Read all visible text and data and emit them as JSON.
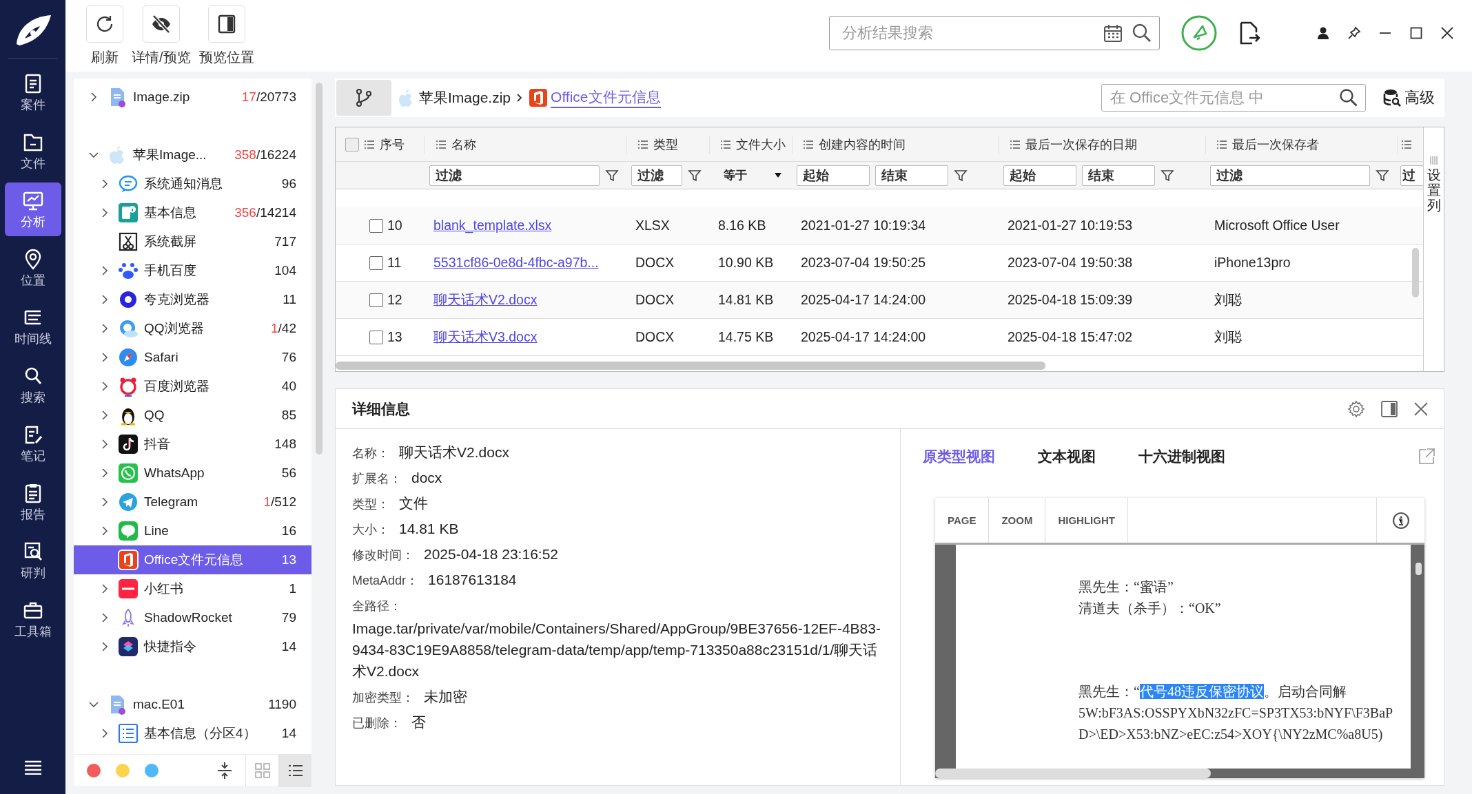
{
  "nav": {
    "items": [
      {
        "label": "案件",
        "selected": false
      },
      {
        "label": "文件",
        "selected": false
      },
      {
        "label": "分析",
        "selected": true
      },
      {
        "label": "位置",
        "selected": false
      },
      {
        "label": "时间线",
        "selected": false
      },
      {
        "label": "搜索",
        "selected": false
      },
      {
        "label": "笔记",
        "selected": false
      },
      {
        "label": "报告",
        "selected": false
      },
      {
        "label": "研判",
        "selected": false
      },
      {
        "label": "工具箱",
        "selected": false
      }
    ]
  },
  "toolbar": {
    "buttons": [
      {
        "label": "刷新"
      },
      {
        "label": "详情/预览"
      },
      {
        "label": "预览位置"
      }
    ]
  },
  "search": {
    "placeholder": "分析结果搜索"
  },
  "tree": [
    {
      "label": "Image.zip",
      "flagged": "17",
      "total": "/20773",
      "expandable": true,
      "expanded": false,
      "selected": false
    },
    {
      "label": "苹果Image...",
      "flagged": "358",
      "total": "/16224",
      "expandable": true,
      "expanded": true,
      "selected": false,
      "children": [
        {
          "label": "系统通知消息",
          "total": "96",
          "expandable": true,
          "expanded": false,
          "selected": false
        },
        {
          "label": "基本信息",
          "flagged": "356",
          "total": "/14214",
          "expandable": true,
          "expanded": false,
          "selected": false
        },
        {
          "label": "系统截屏",
          "total": "717",
          "expandable": false,
          "expanded": false,
          "selected": false
        },
        {
          "label": "手机百度",
          "total": "104",
          "expandable": true,
          "expanded": false,
          "selected": false
        },
        {
          "label": "夸克浏览器",
          "total": "11",
          "expandable": true,
          "expanded": false,
          "selected": false
        },
        {
          "label": "QQ浏览器",
          "flagged": "1",
          "total": "/42",
          "expandable": true,
          "expanded": false,
          "selected": false
        },
        {
          "label": "Safari",
          "total": "76",
          "expandable": true,
          "expanded": false,
          "selected": false
        },
        {
          "label": "百度浏览器",
          "total": "40",
          "expandable": true,
          "expanded": false,
          "selected": false
        },
        {
          "label": "QQ",
          "total": "85",
          "expandable": true,
          "expanded": false,
          "selected": false
        },
        {
          "label": "抖音",
          "total": "148",
          "expandable": true,
          "expanded": false,
          "selected": false
        },
        {
          "label": "WhatsApp",
          "total": "56",
          "expandable": true,
          "expanded": false,
          "selected": false
        },
        {
          "label": "Telegram",
          "flagged": "1",
          "total": "/512",
          "expandable": true,
          "expanded": false,
          "selected": false
        },
        {
          "label": "Line",
          "total": "16",
          "expandable": true,
          "expanded": false,
          "selected": false
        },
        {
          "label": "Office文件元信息",
          "total": "13",
          "expandable": false,
          "expanded": false,
          "selected": true
        },
        {
          "label": "小红书",
          "total": "1",
          "expandable": true,
          "expanded": false,
          "selected": false
        },
        {
          "label": "ShadowRocket",
          "total": "79",
          "expandable": true,
          "expanded": false,
          "selected": false
        },
        {
          "label": "快捷指令",
          "total": "14",
          "expandable": true,
          "expanded": false,
          "selected": false
        }
      ]
    },
    {
      "label": "mac.E01",
      "total": "1190",
      "expandable": true,
      "expanded": true,
      "selected": false,
      "children": [
        {
          "label": "基本信息（分区4）",
          "total": "14",
          "expandable": true,
          "expanded": false,
          "selected": false
        }
      ]
    }
  ],
  "tree_footer": {
    "color_tags": [
      {
        "color": "#f25c5c"
      },
      {
        "color": "#fcd34d"
      },
      {
        "color": "#4fb8f5"
      }
    ],
    "view_modes": [
      {
        "selected": false
      },
      {
        "selected": true
      }
    ]
  },
  "breadcrumb": [
    {
      "label": "苹果Image.zip",
      "selected": false
    },
    {
      "label": "Office文件元信息",
      "selected": true
    }
  ],
  "table_search": {
    "placeholder": "在 Office文件元信息 中"
  },
  "advanced_button": "高级",
  "table": {
    "columns": [
      {
        "label": "序号"
      },
      {
        "label": "名称",
        "filter": {
          "kind": "text",
          "placeholder": "过滤"
        }
      },
      {
        "label": "类型",
        "filter": {
          "kind": "text",
          "placeholder": "过滤"
        }
      },
      {
        "label": "文件大小",
        "filter": {
          "kind": "select",
          "value": "等于"
        }
      },
      {
        "label": "创建内容的时间",
        "filter": {
          "kind": "range",
          "from": {
            "placeholder": "起始"
          },
          "to": {
            "placeholder": "结束"
          }
        }
      },
      {
        "label": "最后一次保存的日期",
        "filter": {
          "kind": "range",
          "from": {
            "placeholder": "起始"
          },
          "to": {
            "placeholder": "结束"
          }
        }
      },
      {
        "label": "最后一次保存者",
        "filter": {
          "kind": "text",
          "placeholder": "过滤"
        }
      },
      {
        "filter": {
          "kind": "text",
          "placeholder": "过"
        }
      }
    ],
    "all_checked": false,
    "settings_column": "设置列",
    "rows": [
      {
        "checked": false,
        "cells": [
          "10",
          "blank_template.xlsx",
          "XLSX",
          "8.16 KB",
          "2021-01-27 10:19:34",
          "2021-01-27 10:19:53",
          "Microsoft Office User"
        ]
      },
      {
        "checked": false,
        "cells": [
          "11",
          "5531cf86-0e8d-4fbc-a97b...",
          "DOCX",
          "10.90 KB",
          "2023-07-04 19:50:25",
          "2023-07-04 19:50:38",
          "iPhone13pro"
        ]
      },
      {
        "checked": false,
        "cells": [
          "12",
          "聊天话术V2.docx",
          "DOCX",
          "14.81 KB",
          "2025-04-17 14:24:00",
          "2025-04-18 15:09:39",
          "刘聪"
        ]
      },
      {
        "checked": false,
        "cells": [
          "13",
          "聊天话术V3.docx",
          "DOCX",
          "14.75 KB",
          "2025-04-17 14:24:00",
          "2025-04-18 15:47:02",
          "刘聪"
        ]
      }
    ]
  },
  "details": {
    "title": "详细信息",
    "fields": [
      {
        "kind": "inline",
        "label": "名称：",
        "value": "聊天话术V2.docx"
      },
      {
        "kind": "inline",
        "label": "扩展名：",
        "value": "docx"
      },
      {
        "kind": "inline",
        "label": "类型：",
        "value": "文件"
      },
      {
        "kind": "inline",
        "label": "大小：",
        "value": "14.81 KB"
      },
      {
        "kind": "inline",
        "label": "修改时间：",
        "value": "2025-04-18 23:16:52"
      },
      {
        "kind": "inline",
        "label": "MetaAddr：",
        "value": "16187613184"
      },
      {
        "kind": "block",
        "label": "全路径：",
        "value": "Image.tar/private/var/mobile/Containers/Shared/AppGroup/9BE37656-12EF-4B83-9434-83C19E9A8858/telegram-data/temp/app/temp-713350a88c23151d/1/聊天话术V2.docx"
      },
      {
        "kind": "inline",
        "label": "加密类型：",
        "value": "未加密"
      },
      {
        "kind": "inline",
        "label": "已删除：",
        "value": "否"
      }
    ]
  },
  "preview": {
    "tabs": [
      {
        "label": "原类型视图",
        "selected": true
      },
      {
        "label": "文本视图",
        "selected": false
      },
      {
        "label": "十六进制视图",
        "selected": false
      }
    ],
    "tools": [
      "PAGE",
      "ZOOM",
      "HIGHLIGHT"
    ],
    "paragraphs": [
      [
        [
          {
            "text": "黑先生：“蜜语”",
            "highlighted": false
          }
        ],
        [
          {
            "text": "清道夫（杀手）：“OK”",
            "highlighted": false
          }
        ]
      ],
      [
        [
          {
            "text": "黑先生：“",
            "highlighted": false
          },
          {
            "text": "代号48违反保密协议",
            "highlighted": true
          },
          {
            "text": "。启动合同解",
            "highlighted": false
          }
        ],
        [
          {
            "text": "5W:bF3AS:OSSPYXbN32zFC=SP3TX53:bNYF\\F3BaP",
            "highlighted": false
          }
        ],
        [
          {
            "text": "D>\\ED>X53:bNZ>eEC:z54>XOY{\\NY2zMC%a8U5)",
            "highlighted": false
          }
        ]
      ]
    ]
  }
}
